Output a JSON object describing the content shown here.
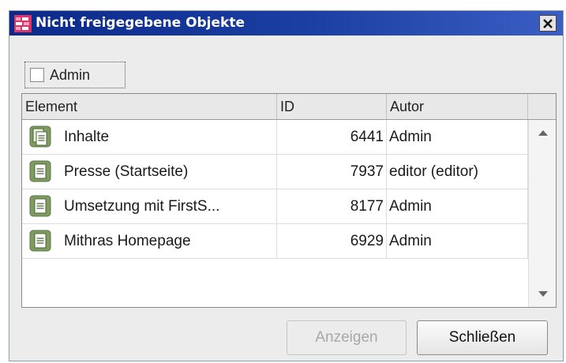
{
  "window": {
    "title": "Nicht freigegebene Objekte"
  },
  "filter": {
    "checkbox_label": "Admin",
    "checked": false
  },
  "table": {
    "columns": [
      "Element",
      "ID",
      "Autor"
    ],
    "rows": [
      {
        "icon": "pages-stack-icon",
        "name": "Inhalte",
        "id": "6441",
        "author": "Admin"
      },
      {
        "icon": "page-icon",
        "name": "Presse (Startseite)",
        "id": "7937",
        "author": "editor (editor)"
      },
      {
        "icon": "page-icon",
        "name": "Umsetzung mit FirstS...",
        "id": "8177",
        "author": "Admin"
      },
      {
        "icon": "page-icon",
        "name": "Mithras Homepage",
        "id": "6929",
        "author": "Admin"
      }
    ]
  },
  "buttons": {
    "show_label": "Anzeigen",
    "close_label": "Schließen"
  },
  "colors": {
    "titlebar": "#0b2a8a",
    "icon_green": "#7a9a5a"
  }
}
